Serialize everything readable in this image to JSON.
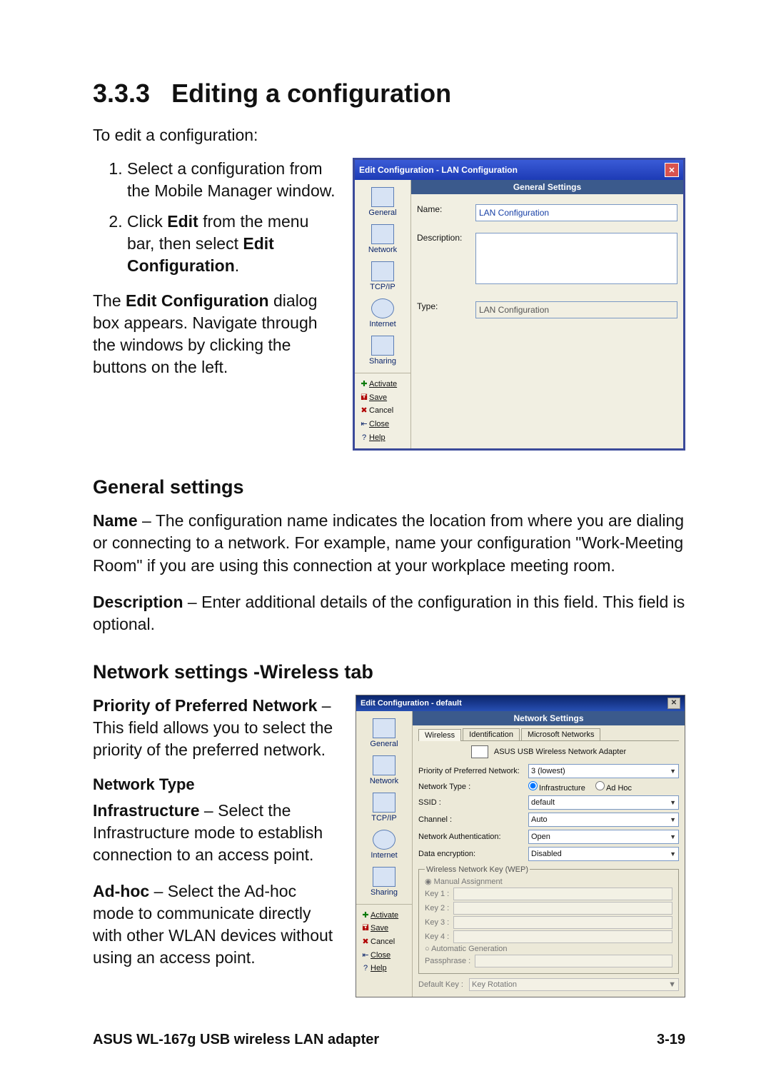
{
  "doc": {
    "section_number": "3.3.3",
    "section_title": "Editing a configuration",
    "intro": "To edit a configuration:",
    "step1": "Select a configuration from the Mobile Manager window.",
    "step2_pre": "Click ",
    "step2_bold1": "Edit",
    "step2_mid": " from the menu bar, then select ",
    "step2_bold2": "Edit Configuration",
    "step2_post": ".",
    "after_steps_pre": "The ",
    "after_steps_bold": "Edit Configuration",
    "after_steps_post": " dialog box appears. Navigate through the windows by clicking the buttons on the left.",
    "h_general": "General settings",
    "name_bold": "Name",
    "name_text": " – The configuration name indicates the location from where you are dialing or connecting to a network. For example, name your configuration \"Work-Meeting Room\" if you are using this connection at your workplace meeting room.",
    "desc_bold": "Description",
    "desc_text": " – Enter additional details of the configuration in this field. This field is optional.",
    "h_network": "Network settings -Wireless tab",
    "priority_bold": "Priority of Preferred Network",
    "priority_text": " – This field allows you to select the priority of the preferred network.",
    "h_ntype": "Network Type",
    "infra_bold": "Infrastructure",
    "infra_text": " – Select the Infrastructure mode to establish connection to an access point.",
    "adhoc_bold": "Ad-hoc",
    "adhoc_text": " – Select the Ad-hoc mode to communicate directly with other WLAN devices without using an access point.",
    "footer_left": "ASUS WL-167g USB wireless LAN adapter",
    "footer_right": "3-19"
  },
  "dlg1": {
    "title": "Edit Configuration - LAN Configuration",
    "header": "General Settings",
    "nav": {
      "general": "General",
      "network": "Network",
      "tcpip": "TCP/IP",
      "internet": "Internet",
      "sharing": "Sharing"
    },
    "actions": {
      "activate": "Activate",
      "save": "Save",
      "cancel": "Cancel",
      "close": "Close",
      "help": "Help"
    },
    "labels": {
      "name": "Name:",
      "description": "Description:",
      "type": "Type:"
    },
    "values": {
      "name": "LAN Configuration",
      "description": "",
      "type": "LAN Configuration"
    }
  },
  "dlg2": {
    "title": "Edit Configuration - default",
    "header": "Network Settings",
    "tabs": {
      "wireless": "Wireless",
      "ident": "Identification",
      "ms": "Microsoft Networks"
    },
    "adapter": "ASUS USB Wireless Network Adapter",
    "nav": {
      "general": "General",
      "network": "Network",
      "tcpip": "TCP/IP",
      "internet": "Internet",
      "sharing": "Sharing"
    },
    "actions": {
      "activate": "Activate",
      "save": "Save",
      "cancel": "Cancel",
      "close": "Close",
      "help": "Help"
    },
    "labels": {
      "priority": "Priority of Preferred Network:",
      "ntype": "Network Type :",
      "infra": "Infrastructure",
      "adhoc": "Ad Hoc",
      "ssid": "SSID :",
      "channel": "Channel :",
      "auth": "Network Authentication:",
      "enc": "Data encryption:",
      "wep_legend": "Wireless Network Key (WEP)",
      "manual": "Manual Assignment",
      "k1": "Key 1 :",
      "k2": "Key 2 :",
      "k3": "Key 3 :",
      "k4": "Key 4 :",
      "auto": "Automatic Generation",
      "pass": "Passphrase :",
      "defkey": "Default Key :",
      "keyrot": "Key Rotation"
    },
    "values": {
      "priority": "3 (lowest)",
      "ssid": "default",
      "channel": "Auto",
      "auth": "Open",
      "enc": "Disabled"
    }
  }
}
